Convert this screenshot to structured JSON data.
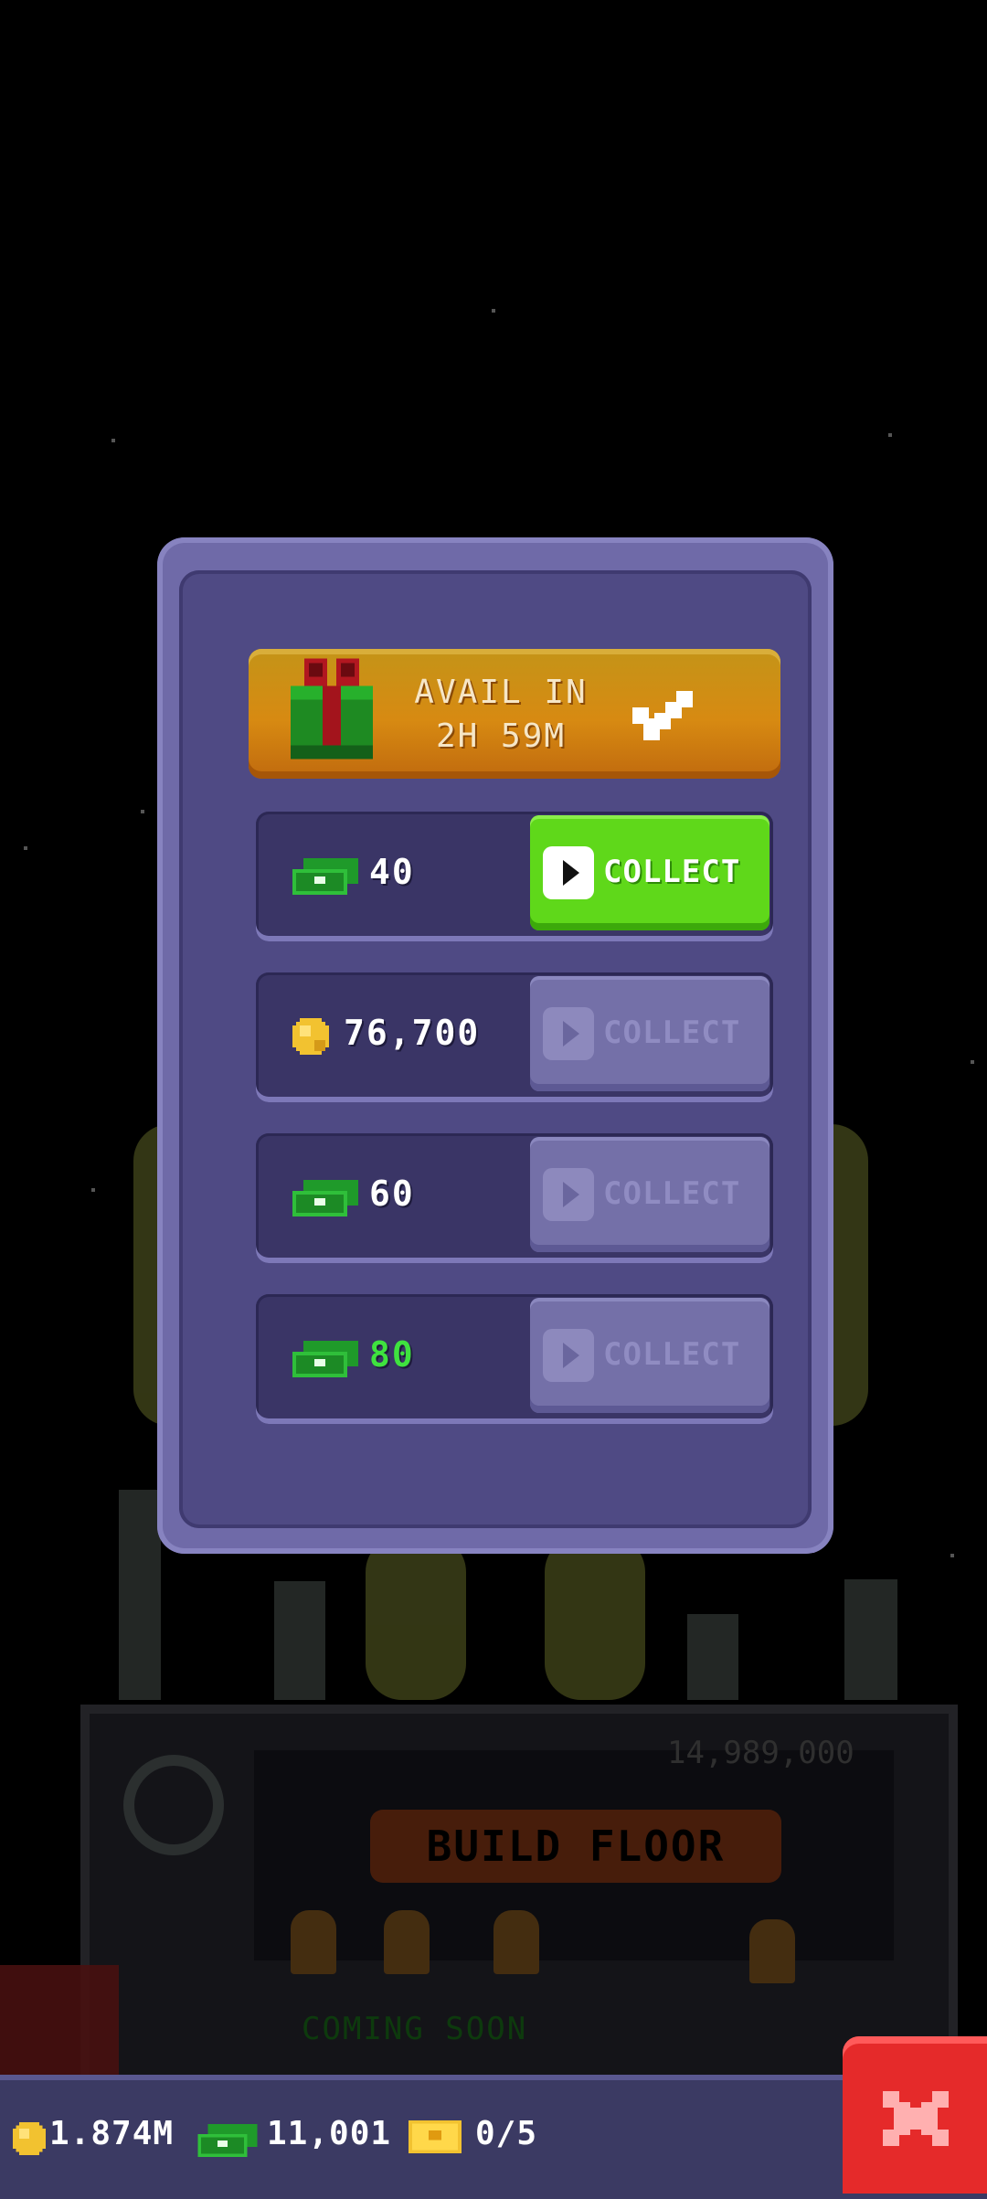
{
  "gift_banner": {
    "line1": "AVAIL IN",
    "line2": "2H 59M"
  },
  "rewards": [
    {
      "icon": "bux-icon",
      "amount": "40",
      "button_label": "COLLECT",
      "button_state": "active"
    },
    {
      "icon": "coin-icon",
      "amount": "76,700",
      "button_label": "COLLECT",
      "button_state": "disabled"
    },
    {
      "icon": "bux-icon",
      "amount": "60",
      "button_label": "COLLECT",
      "button_state": "disabled"
    },
    {
      "icon": "bux-icon",
      "amount": "80",
      "button_label": "COLLECT",
      "button_state": "disabled"
    }
  ],
  "background": {
    "build_button": "BUILD FLOOR",
    "floor_price": "14,989,000",
    "coming_soon": "COMING SOON"
  },
  "status_bar": {
    "coins": "1.874M",
    "bux": "11,001",
    "tickets": "0/5"
  },
  "colors": {
    "collect_active": "#5fd81a",
    "collect_disabled": "#7470a8",
    "close_button": "#e52a2a",
    "panel": "#4f4a84"
  }
}
